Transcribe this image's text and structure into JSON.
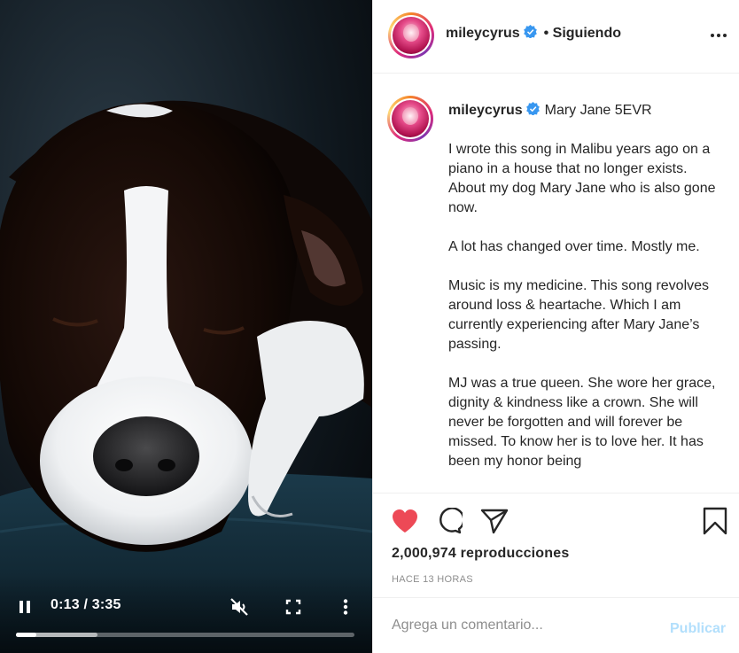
{
  "video": {
    "current_time": "0:13",
    "separator": " / ",
    "duration": "3:35",
    "progress_fraction": 0.0605,
    "buffered_fraction": 0.24,
    "state": "playing",
    "muted": true,
    "controls": {
      "pause_icon": "pause-icon",
      "mute_icon": "speaker-muted-icon",
      "fullscreen_icon": "fullscreen-icon",
      "menu_icon": "vertical-dots-icon"
    }
  },
  "header": {
    "username": "mileycyrus",
    "verified_icon": "verified-badge-icon",
    "follow_status": "• Siguiendo",
    "more_icon": "horizontal-dots-icon"
  },
  "caption": {
    "username": "mileycyrus",
    "title": "Mary Jane 5EVR",
    "paragraphs": [
      "I wrote this song in Malibu years ago on a piano in a house that no longer exists. About my dog Mary Jane who is also gone now.",
      "A lot has changed over time. Mostly me.",
      "Music is my medicine. This song revolves around loss & heartache. Which I am currently experiencing after Mary Jane’s passing.",
      "MJ was a true queen. She wore her grace, dignity & kindness like a crown. She will never be forgotten and will forever be missed. To know her is to love her. It has been my honor being"
    ]
  },
  "actions": {
    "like_icon": "heart-filled-icon",
    "comment_icon": "comment-bubble-icon",
    "share_icon": "paper-plane-icon",
    "save_icon": "bookmark-icon",
    "liked": true,
    "like_color": "#ed4956",
    "views_count": "2,000,974",
    "views_label": "reproducciones",
    "views_text": "2,000,974 reproducciones",
    "time_ago": "HACE 13 HORAS"
  },
  "comment": {
    "placeholder": "Agrega un comentario...",
    "value": "",
    "publish_label": "Publicar",
    "publish_color": "#b2dffc"
  },
  "colors": {
    "verified_blue": "#3897f0",
    "text": "#262626",
    "muted_text": "#8e8e8e",
    "divider": "#efefef"
  }
}
